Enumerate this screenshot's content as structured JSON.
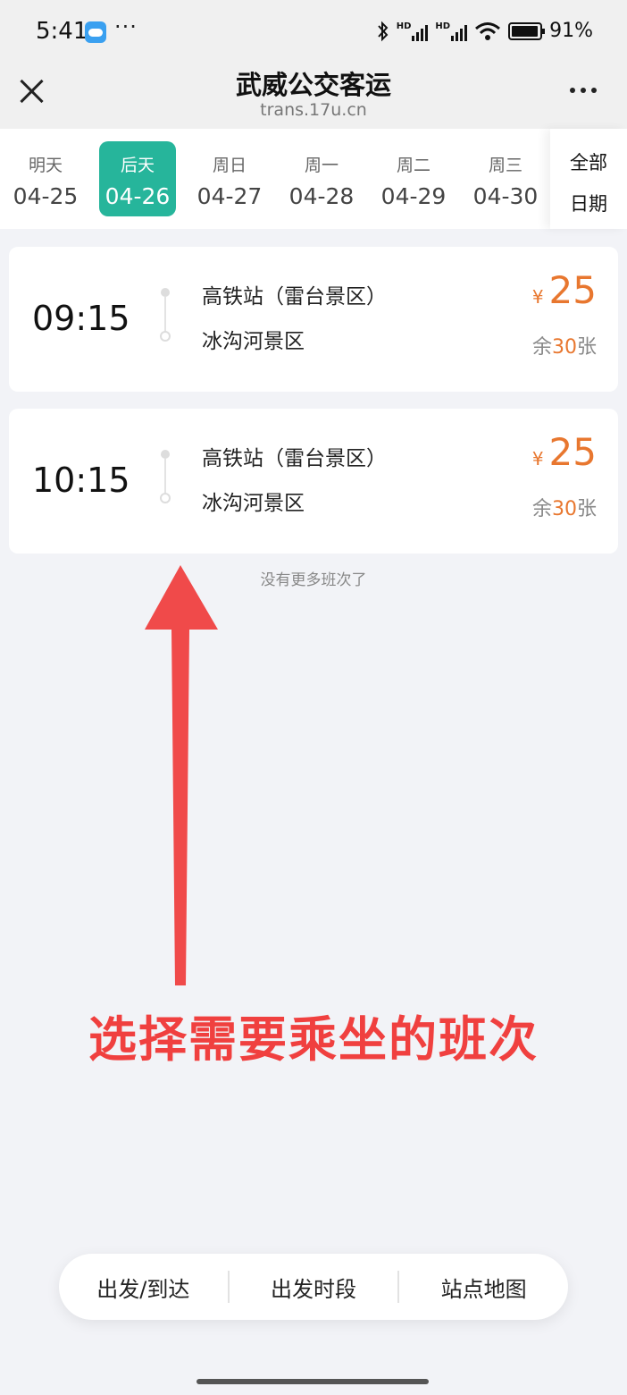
{
  "status_bar": {
    "time": "5:41",
    "more": "···",
    "hd1": "HD",
    "hd2": "HD",
    "battery": "91%"
  },
  "header": {
    "title": "武威公交客运",
    "subtitle": "trans.17u.cn"
  },
  "dates": [
    {
      "label": "明天",
      "date": "04-25",
      "active": false
    },
    {
      "label": "后天",
      "date": "04-26",
      "active": true
    },
    {
      "label": "周日",
      "date": "04-27",
      "active": false
    },
    {
      "label": "周一",
      "date": "04-28",
      "active": false
    },
    {
      "label": "周二",
      "date": "04-29",
      "active": false
    },
    {
      "label": "周三",
      "date": "04-30",
      "active": false
    }
  ],
  "all_dates": {
    "line1": "全部",
    "line2": "日期"
  },
  "trips": [
    {
      "time": "09:15",
      "from": "高铁站（雷台景区）",
      "to": "冰沟河景区",
      "currency": "¥",
      "price": "25",
      "seats_prefix": "余",
      "seats": "30",
      "seats_suffix": "张"
    },
    {
      "time": "10:15",
      "from": "高铁站（雷台景区）",
      "to": "冰沟河景区",
      "currency": "¥",
      "price": "25",
      "seats_prefix": "余",
      "seats": "30",
      "seats_suffix": "张"
    }
  ],
  "no_more": "没有更多班次了",
  "annotation": "选择需要乘坐的班次",
  "filters": [
    "出发/到达",
    "出发时段",
    "站点地图"
  ],
  "colors": {
    "accent": "#26b59b",
    "price": "#e8772f",
    "annotation": "#f0403f"
  }
}
